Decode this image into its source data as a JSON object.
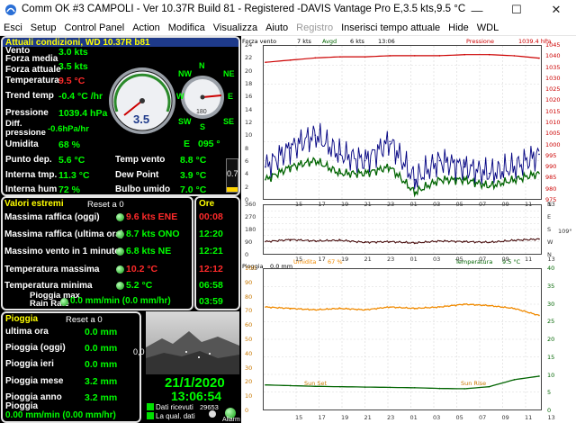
{
  "window": {
    "title": "Comm OK  #3 CAMPOLI - Ver 10.37R Build 81 - Registered  -DAVIS Vantage Pro  E,3.5 kts,9.5 °C",
    "minimize": "—",
    "maximize": "☐",
    "close": "✕"
  },
  "menu": [
    "Esci",
    "Setup",
    "Control Panel",
    "Action",
    "Modifica",
    "Visualizza",
    "Aiuto",
    "Registro",
    "Inserisci tempo attuale",
    "Hide",
    "WDL"
  ],
  "current": {
    "header": "Attuali condizioni, WD 10.37R b81",
    "vento_label": "Vento",
    "vento": "3.0 kts",
    "forza_media_label": "Forza media",
    "forza_media": "3.5 kts",
    "forza_attuale_label": "Forza attuale",
    "temperatura_label": "Temperatura",
    "temperatura": "9.5 °C",
    "trend_temp_label": "Trend temp",
    "trend_temp": "-0.4 °C /hr",
    "pressione_label": "Pressione",
    "pressione": "1039.4 hPa",
    "diff_pressione_label": "Diff. pressione",
    "diff_pressione": "-0.6hPa/hr",
    "umidita_label": "Umidita",
    "umidita": "68 %",
    "punto_dep_label": "Punto dep.",
    "punto_dep": "5.6 °C",
    "interna_temp_label": "Interna tmp.",
    "interna_temp": "11.3 °C",
    "interna_hum_label": "Interna hum",
    "interna_hum": "72 %",
    "temp_vento_label": "Temp vento",
    "temp_vento": "8.8 °C",
    "dew_point_label": "Dew Point",
    "dew_point": "3.9 °C",
    "bulbo_label": "Bulbo umido",
    "bulbo": "7.0 °C",
    "gauge_value": "3.5",
    "compass_dir": "E",
    "compass_deg": "095 °",
    "compass_n": "N",
    "compass_ne": "NE",
    "compass_nw": "NW",
    "compass_s": "S",
    "compass_se": "SE",
    "compass_sw": "SW",
    "compass_e": "E",
    "compass_w": "W",
    "compass_inner": "180",
    "side_value": "0.7"
  },
  "extremes": {
    "header": "Valori estremi",
    "reset": "Reset a 0",
    "ore_header": "Ore",
    "rows": [
      {
        "label": "Massima raffica (oggi)",
        "value": "9.6 kts ENE",
        "time": "00:08",
        "red": true
      },
      {
        "label": "Massima raffica (ultima ora)",
        "value": "8.7 kts ONO",
        "time": "12:20",
        "red": false
      },
      {
        "label": "Massimo vento in 1 minuto",
        "value": "6.8 kts  NE",
        "time": "12:21",
        "red": false
      },
      {
        "label": "Temperatura massima",
        "value": "10.2 °C",
        "time": "12:12",
        "red": true
      },
      {
        "label": "Temperatura minima",
        "value": "5.2 °C",
        "time": "06:58",
        "red": false
      },
      {
        "label": "Pioggia max Rain Rate",
        "value": "0.0 mm/min (0.0 mm/hr)",
        "time": "03:59",
        "red": false
      }
    ]
  },
  "rain": {
    "header": "Pioggia",
    "reset": "Reset a 0",
    "rows": [
      {
        "label": "ultima ora",
        "value": "0.0 mm"
      },
      {
        "label": "Pioggia (oggi)",
        "value": "0.0 mm"
      },
      {
        "label": "Pioggia ieri",
        "value": "0.0 mm"
      },
      {
        "label": "Pioggia mese",
        "value": "3.2 mm"
      },
      {
        "label": "Pioggia anno",
        "value": "3.2 mm"
      }
    ],
    "last_label": "Pioggia",
    "rate": "0.00 mm/min (0.00 mm/hr)"
  },
  "webcam": {
    "side_value": "0,0",
    "date": "21/1/2020",
    "time": "13:06:54",
    "dati_ricevuti_label": "Dati ricevuti",
    "dati_ricevuti": "29653",
    "qual_label": "La qual. dati",
    "allarm_label": "Allarm"
  },
  "chart_top": {
    "label_left": "Forza vento",
    "kts": "7 kts",
    "avgd_label": "Avgd",
    "avgd": "6 kts",
    "time": "13:06",
    "pressione_label": "Pressione",
    "pressione": "1039.4 hPa",
    "colors": {
      "wind": "#000080",
      "avg": "#006400",
      "pressure": "#cc0000"
    }
  },
  "chart_mid": {
    "value": "109°",
    "colors": {
      "dir": "#4a1010"
    }
  },
  "chart_bottom": {
    "pioggia_label": "Pioggia",
    "pioggia": "0.0 mm",
    "umidita_label": "Umidita",
    "umidita": "67 %",
    "temperatura_label": "Temperatura",
    "temperatura": "9.5 °C",
    "sun_rise": "Sun Rise",
    "sun_set": "Sun Set",
    "colors": {
      "humidity": "#f08a00",
      "temp": "#006400"
    }
  },
  "chart_data": [
    {
      "type": "line",
      "title": "Forza vento / Pressione",
      "x": [
        "15",
        "17",
        "19",
        "21",
        "23",
        "01",
        "03",
        "05",
        "07",
        "09",
        "11",
        "13"
      ],
      "ylim": [
        0,
        24
      ],
      "y2lim": [
        975,
        1045
      ],
      "y_ticks": [
        "0",
        "2",
        "4",
        "6",
        "8",
        "10",
        "12",
        "14",
        "16",
        "18",
        "20",
        "22",
        "24"
      ],
      "y2_ticks": [
        "975",
        "980",
        "985",
        "990",
        "995",
        "1000",
        "1005",
        "1010",
        "1015",
        "1020",
        "1025",
        "1030",
        "1035",
        "1040",
        "1045"
      ],
      "series": [
        {
          "name": "Forza vento",
          "values": [
            5,
            8,
            10,
            7,
            6,
            9,
            3,
            6,
            5,
            4,
            5,
            7
          ]
        },
        {
          "name": "Avgd",
          "values": [
            3,
            5,
            6,
            4,
            4,
            5,
            1,
            3,
            3,
            2,
            3,
            4
          ]
        },
        {
          "name": "Pressione",
          "values": [
            1037.5,
            1038.5,
            1039.5,
            1040,
            1040,
            1040.5,
            1040.5,
            1040.5,
            1041,
            1041,
            1040.5,
            1039.4
          ]
        }
      ]
    },
    {
      "type": "line",
      "title": "Direzione vento",
      "x": [
        "15",
        "17",
        "19",
        "21",
        "23",
        "01",
        "03",
        "05",
        "07",
        "09",
        "11",
        "13"
      ],
      "ylim": [
        0,
        360
      ],
      "y_ticks": [
        "0",
        "45",
        "90",
        "135",
        "180",
        "225",
        "270",
        "315",
        "360"
      ],
      "y_ticks_right": [
        "N",
        "W",
        "S",
        "E",
        "N"
      ],
      "series": [
        {
          "name": "Direzione",
          "values": [
            90,
            105,
            95,
            100,
            85,
            90,
            80,
            95,
            90,
            85,
            100,
            109
          ]
        }
      ]
    },
    {
      "type": "line",
      "title": "Umidita / Temperatura",
      "x": [
        "15",
        "17",
        "19",
        "21",
        "23",
        "01",
        "03",
        "05",
        "07",
        "09",
        "11",
        "13"
      ],
      "ylim": [
        0,
        100
      ],
      "y2lim": [
        0,
        40
      ],
      "y_ticks": [
        "0",
        "10",
        "20",
        "30",
        "40",
        "50",
        "60",
        "70",
        "80",
        "90",
        "100"
      ],
      "y2_ticks": [
        "0",
        "5",
        "10",
        "15",
        "20",
        "25",
        "30",
        "35",
        "40"
      ],
      "series": [
        {
          "name": "Umidita",
          "values": [
            73,
            72,
            71,
            72,
            71,
            73,
            72,
            73,
            75,
            74,
            72,
            67
          ]
        },
        {
          "name": "Temperatura",
          "values": [
            7,
            6.8,
            6.6,
            6.5,
            6.4,
            6.3,
            6.2,
            6.0,
            5.9,
            6.5,
            8.5,
            9.5
          ]
        }
      ]
    }
  ]
}
